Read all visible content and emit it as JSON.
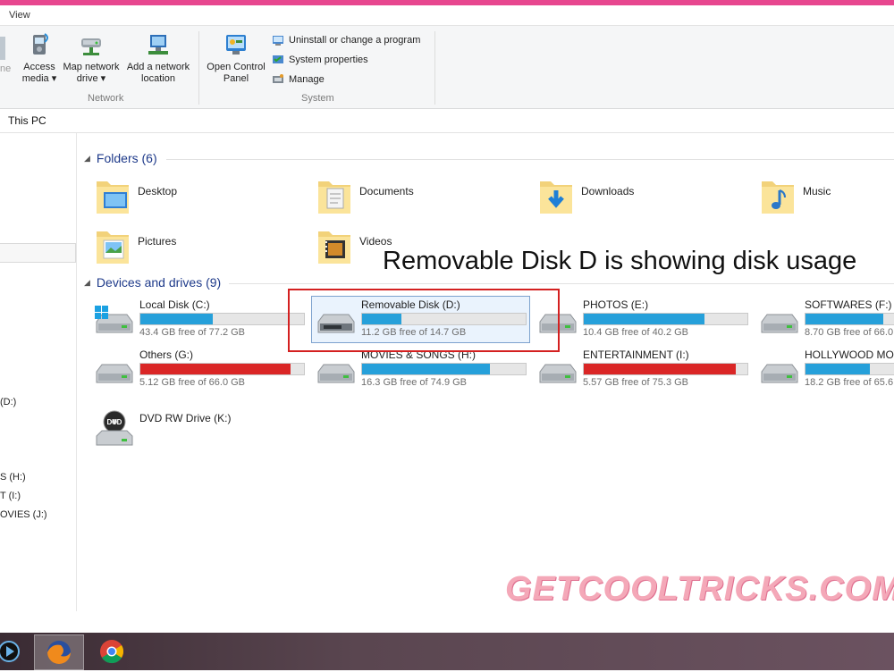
{
  "menu": {
    "view": "View"
  },
  "ribbon": {
    "truncated_left": "ne",
    "access_media": {
      "line1": "Access",
      "line2": "media ▾"
    },
    "map_network_drive": {
      "line1": "Map network",
      "line2": "drive ▾"
    },
    "add_network_location": {
      "line1": "Add a network",
      "line2": "location"
    },
    "group_network": "Network",
    "open_control_panel": {
      "line1": "Open Control",
      "line2": "Panel"
    },
    "uninstall": "Uninstall or change a program",
    "system_properties": "System properties",
    "manage": "Manage",
    "group_system": "System"
  },
  "address": {
    "path": "This PC"
  },
  "nav": {
    "items": [
      "(D:)",
      "S (H:)",
      "T (I:)",
      "OVIES (J:)"
    ]
  },
  "folders": {
    "header": "Folders (6)",
    "items": [
      "Desktop",
      "Documents",
      "Downloads",
      "Music",
      "Pictures",
      "Videos"
    ]
  },
  "devices": {
    "header": "Devices and drives (9)",
    "items": [
      {
        "name": "Local Disk (C:)",
        "free": "43.4 GB free of 77.2 GB",
        "used_fraction": 0.44,
        "status": "normal"
      },
      {
        "name": "Removable Disk (D:)",
        "free": "11.2 GB free of 14.7 GB",
        "used_fraction": 0.24,
        "status": "normal"
      },
      {
        "name": "PHOTOS (E:)",
        "free": "10.4 GB free of 40.2 GB",
        "used_fraction": 0.74,
        "status": "normal"
      },
      {
        "name": "SOFTWARES (F:)",
        "free": "8.70 GB free of 66.0",
        "used_fraction": 0.87,
        "status": "normal"
      },
      {
        "name": "Others (G:)",
        "free": "5.12 GB free of 66.0 GB",
        "used_fraction": 0.92,
        "status": "critical"
      },
      {
        "name": "MOVIES & SONGS (H:)",
        "free": "16.3 GB free of 74.9 GB",
        "used_fraction": 0.78,
        "status": "normal"
      },
      {
        "name": "ENTERTAINMENT (I:)",
        "free": "5.57 GB free of 75.3 GB",
        "used_fraction": 0.93,
        "status": "critical"
      },
      {
        "name": "HOLLYWOOD MOV",
        "free": "18.2 GB free of 65.6",
        "used_fraction": 0.72,
        "status": "normal"
      }
    ],
    "dvd": {
      "name": "DVD RW Drive (K:)",
      "label": "DVD"
    }
  },
  "annotation": {
    "text": "Removable Disk D is showing disk usage"
  },
  "watermark": {
    "text": "GETCOOLTRICKS.COM"
  },
  "colors": {
    "accent": "#26a0da",
    "critical": "#da2626",
    "callout": "#d42020",
    "title_bar": "#e7478f"
  },
  "taskbar": {
    "items": [
      "media-player-icon",
      "firefox-icon",
      "chrome-icon"
    ]
  }
}
